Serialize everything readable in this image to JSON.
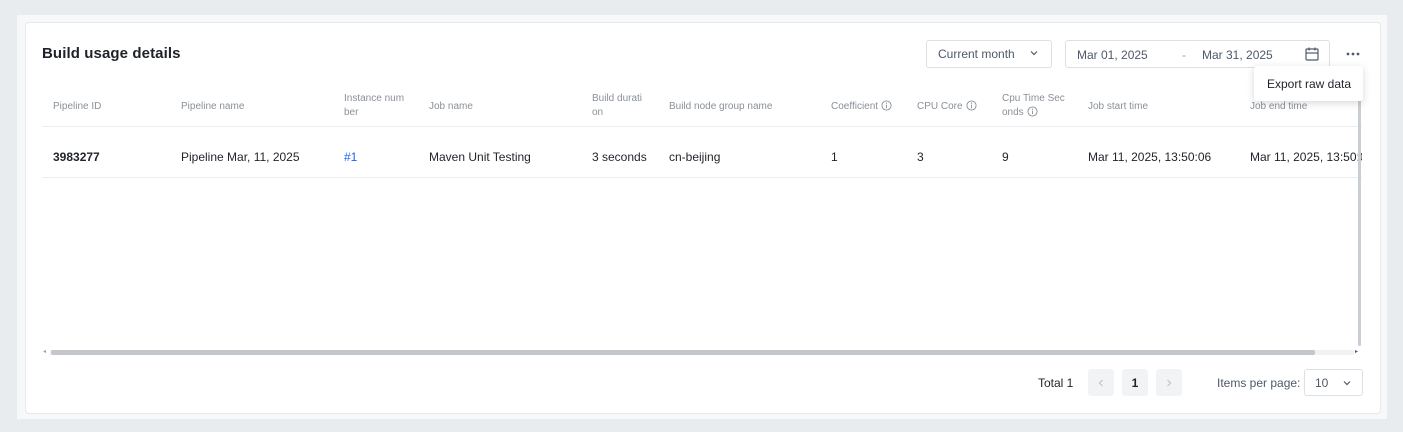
{
  "header": {
    "title": "Build usage details",
    "period_select": "Current month",
    "date_start": "Mar 01, 2025",
    "date_separator": "-",
    "date_end": "Mar 31, 2025"
  },
  "menu": {
    "export_label": "Export raw data"
  },
  "table": {
    "columns": {
      "pipeline_id": "Pipeline ID",
      "pipeline_name": "Pipeline name",
      "instance_number": "Instance num ber",
      "job_name": "Job name",
      "build_duration": "Build durati on",
      "build_node_group": "Build node group name",
      "coefficient": "Coefficient",
      "cpu_core": "CPU Core",
      "cpu_time_seconds": "Cpu Time Sec onds",
      "job_start_time": "Job start time",
      "job_end_time": "Job end time"
    },
    "rows": [
      {
        "pipeline_id": "3983277",
        "pipeline_name": "Pipeline Mar, 11, 2025",
        "instance_number": "#1",
        "job_name": "Maven Unit Testing",
        "build_duration": "3 seconds",
        "build_node_group": "cn-beijing",
        "coefficient": "1",
        "cpu_core": "3",
        "cpu_time_seconds": "9",
        "job_start_time": "Mar 11, 2025, 13:50:06",
        "job_end_time": "Mar 11, 2025, 13:50:0"
      }
    ]
  },
  "pagination": {
    "total_label": "Total 1",
    "prev_icon": "chevron-left-icon",
    "current_page": "1",
    "next_icon": "chevron-right-icon",
    "items_per_page_label": "Items per page:",
    "items_per_page_value": "10"
  },
  "colors": {
    "link": "#1664ff",
    "background": "#e9ecef",
    "card": "#ffffff"
  }
}
